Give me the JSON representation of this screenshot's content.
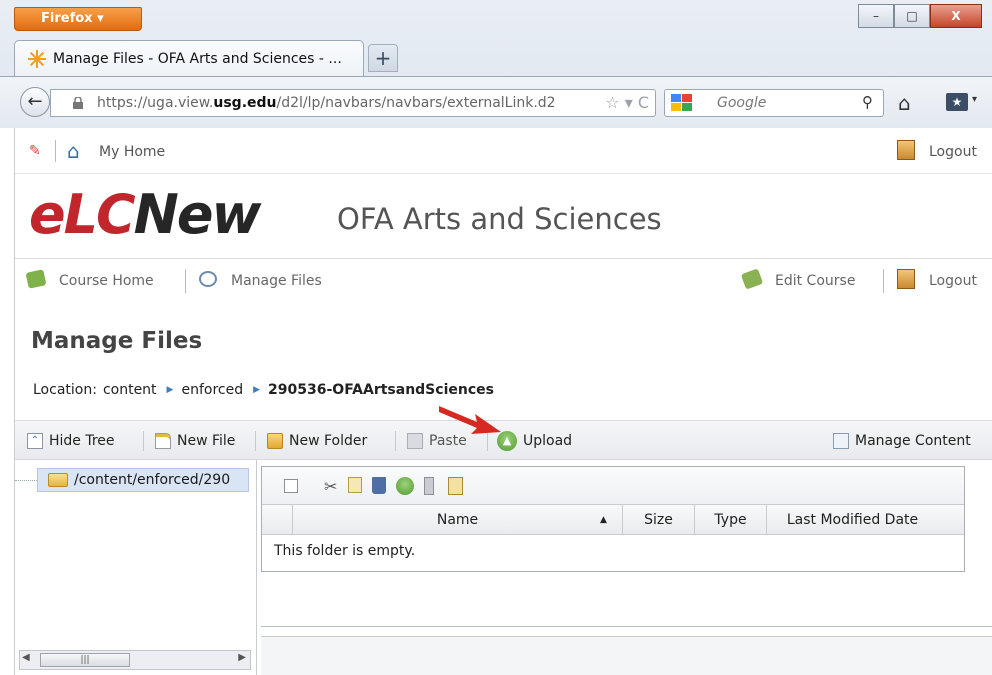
{
  "browser": {
    "app_button": "Firefox",
    "window_controls": [
      "–",
      "□",
      "X"
    ],
    "tab_title": "Manage Files - OFA Arts and Sciences - ...",
    "new_tab_label": "+",
    "url_prefix": "https://uga.view.",
    "url_host_bold": "usg.edu",
    "url_suffix": "/d2l/lp/navbars/navbars/externalLink.d2",
    "url_icons": "☆ ▾ C",
    "search_placeholder": "Google",
    "icons": [
      "back-arrow-icon",
      "lock-icon",
      "star-icon",
      "reload-icon",
      "google-icon",
      "search-icon",
      "home-icon",
      "bookmarks-icon"
    ]
  },
  "page": {
    "top_nav": {
      "my_home": "My Home",
      "logout": "Logout"
    },
    "logo": {
      "e": "e",
      "lc": "LC",
      "new": "New"
    },
    "org_name": "OFA Arts and Sciences",
    "course_nav": {
      "course_home": "Course Home",
      "manage_files": "Manage Files",
      "edit_course": "Edit Course",
      "logout": "Logout"
    },
    "title": "Manage Files",
    "location": {
      "label": "Location:",
      "crumbs": [
        "content",
        "enforced",
        "290536-OFAArtsandSciences"
      ]
    },
    "toolbar": {
      "hide_tree": "Hide Tree",
      "new_file": "New File",
      "new_folder": "New Folder",
      "paste": "Paste",
      "upload": "Upload",
      "manage_content": "Manage Content"
    },
    "tree": {
      "root": "/content/enforced/290"
    },
    "files": {
      "columns": {
        "name": "Name",
        "size": "Size",
        "type": "Type",
        "modified": "Last Modified Date"
      },
      "empty_message": "This folder is empty."
    },
    "colors": {
      "logo_red": "#c0262c",
      "highlight_arrow": "#d42a22",
      "selected_node": "#d9e4f5"
    }
  }
}
